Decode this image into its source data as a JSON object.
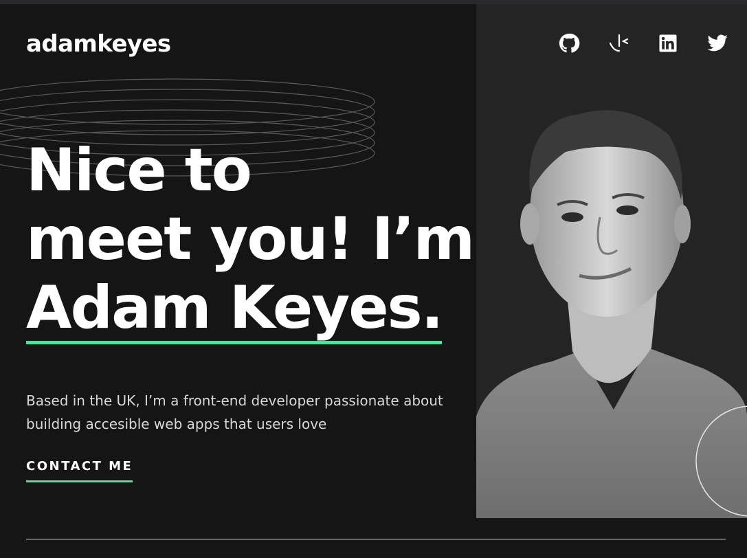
{
  "brand": {
    "name": "adamkeyes"
  },
  "social": [
    {
      "name": "github",
      "icon": "github-icon"
    },
    {
      "name": "frontend-mentor",
      "icon": "frontend-mentor-icon"
    },
    {
      "name": "linkedin",
      "icon": "linkedin-icon"
    },
    {
      "name": "twitter",
      "icon": "twitter-icon"
    }
  ],
  "hero": {
    "line1": "Nice to",
    "line2": "meet you! I’m",
    "name": "Adam Keyes.",
    "bio": "Based in the UK, I’m a front-end developer passionate about building accesible web apps that users love",
    "cta": "CONTACT ME"
  },
  "colors": {
    "background": "#151515",
    "panel": "#242424",
    "accent": "#4ee1a0",
    "text": "#ffffff",
    "muted": "#d9d9d9"
  }
}
